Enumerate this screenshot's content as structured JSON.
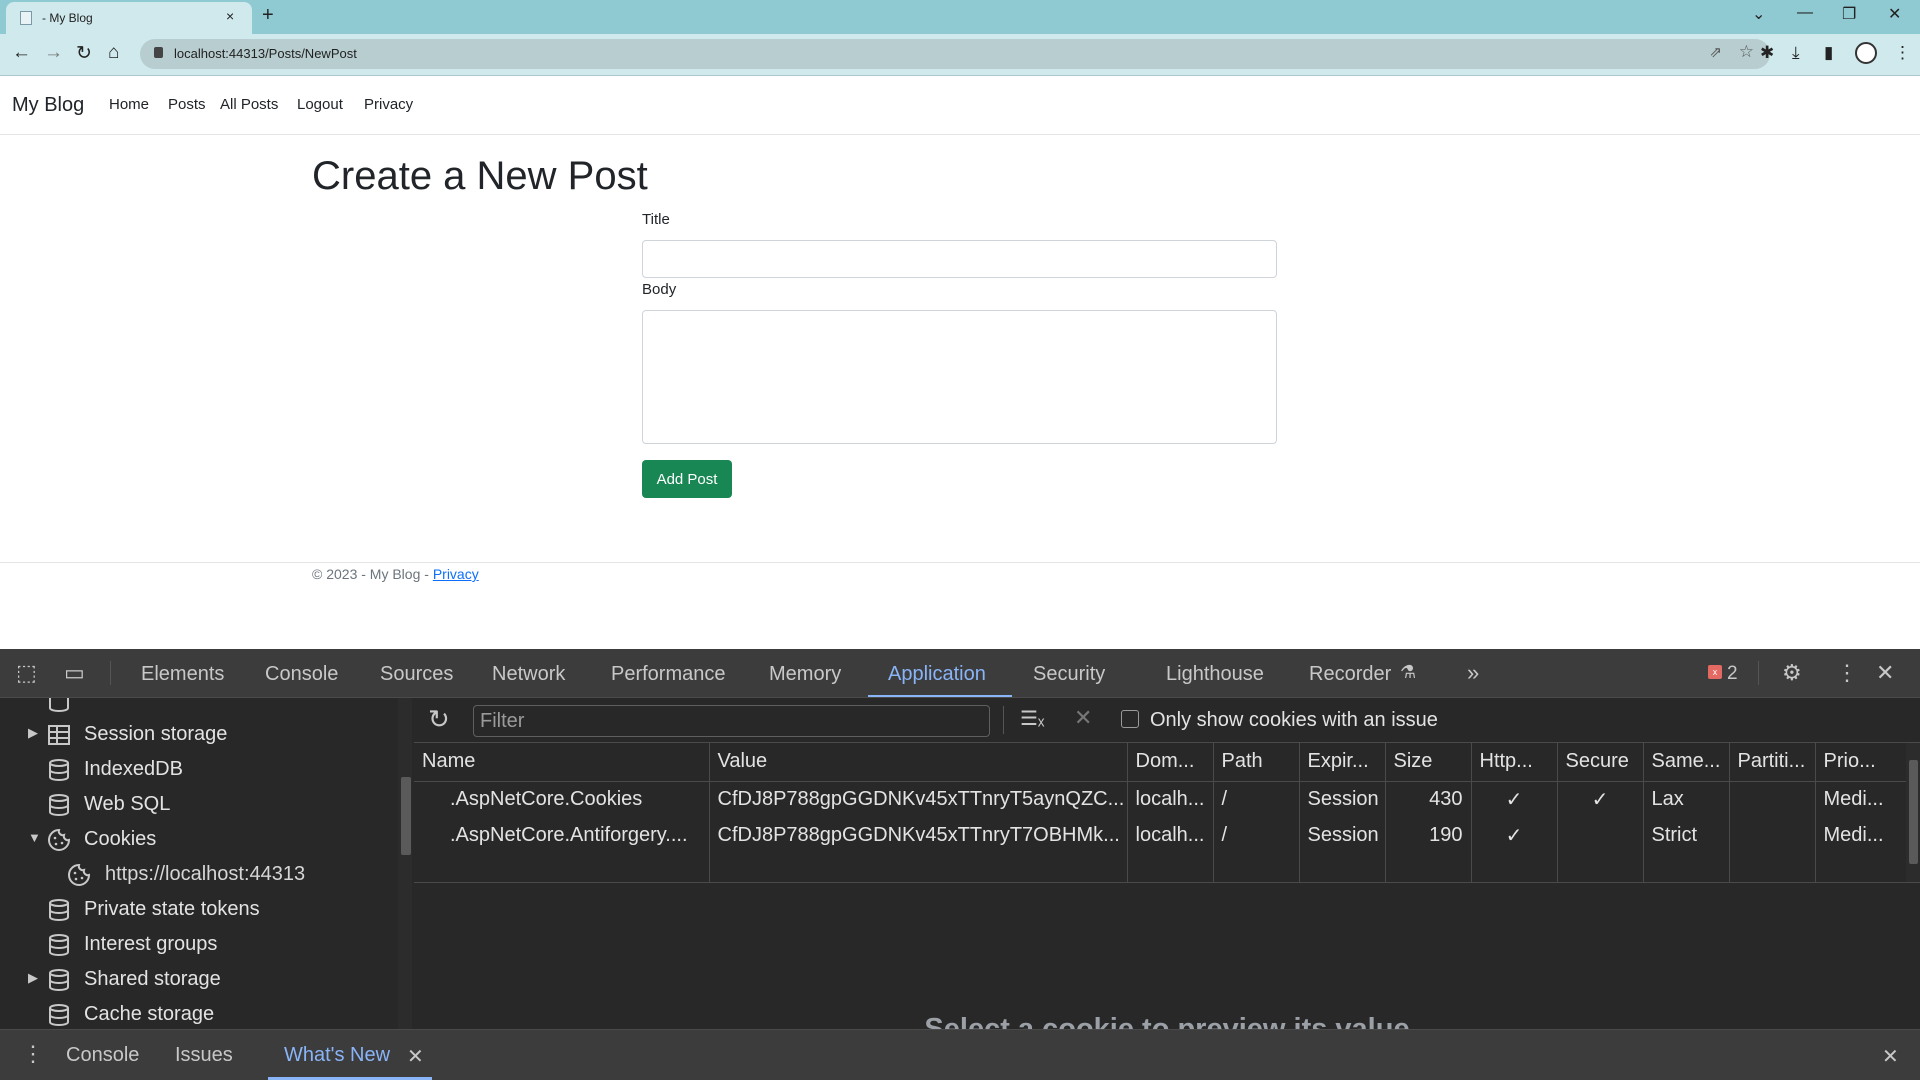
{
  "browser": {
    "tab_title": "- My Blog",
    "tab_close": "×",
    "new_tab": "+",
    "url": "localhost:44313/Posts/NewPost",
    "window_controls": {
      "tab_search": "⌄",
      "minimize": "—",
      "restore": "❐",
      "close": "✕"
    },
    "nav": {
      "back": "←",
      "forward": "→",
      "reload": "↻",
      "home": "⌂"
    },
    "toolbar_icons": {
      "share": "⇗",
      "bookmark": "☆",
      "extensions": "✱",
      "downloads": "⤓",
      "side_panel": "▮",
      "menu": "⋮"
    }
  },
  "page": {
    "brand": "My Blog",
    "nav_links": [
      "Home",
      "Posts",
      "All Posts",
      "Logout",
      "Privacy"
    ],
    "heading": "Create a New Post",
    "form": {
      "title_label": "Title",
      "title_value": "",
      "body_label": "Body",
      "body_value": "",
      "submit_label": "Add Post"
    },
    "footer": {
      "text": "© 2023 - My Blog - ",
      "link": "Privacy"
    }
  },
  "devtools": {
    "tabs": [
      "Elements",
      "Console",
      "Sources",
      "Network",
      "Performance",
      "Memory",
      "Application",
      "Security",
      "Lighthouse",
      "Recorder"
    ],
    "active_tab": "Application",
    "more_tabs": "»",
    "issues_count": "2",
    "sidebar": {
      "items": [
        {
          "label": "Session storage",
          "icon": "table-icon",
          "expandable": true,
          "expanded": false
        },
        {
          "label": "IndexedDB",
          "icon": "database-icon",
          "expandable": false
        },
        {
          "label": "Web SQL",
          "icon": "database-icon",
          "expandable": false
        },
        {
          "label": "Cookies",
          "icon": "cookie-icon",
          "expandable": true,
          "expanded": true
        },
        {
          "label": "https://localhost:44313",
          "icon": "cookie-icon",
          "child": true,
          "selected": true
        },
        {
          "label": "Private state tokens",
          "icon": "database-icon",
          "expandable": false
        },
        {
          "label": "Interest groups",
          "icon": "database-icon",
          "expandable": false
        },
        {
          "label": "Shared storage",
          "icon": "database-icon",
          "expandable": true,
          "expanded": false
        },
        {
          "label": "Cache storage",
          "icon": "database-icon",
          "expandable": false
        }
      ]
    },
    "cookies": {
      "filter_placeholder": "Filter",
      "filter_value": "",
      "only_issues_label": "Only show cookies with an issue",
      "only_issues_checked": false,
      "columns": [
        "Name",
        "Value",
        "Dom...",
        "Path",
        "Expir...",
        "Size",
        "Http...",
        "Secure",
        "Same...",
        "Partiti...",
        "Prio..."
      ],
      "rows": [
        {
          "name": ".AspNetCore.Cookies",
          "value": "CfDJ8P788gpGGDNKv45xTTnryT5aynQZC...",
          "domain": "localh...",
          "path": "/",
          "expires": "Session",
          "size": "430",
          "httponly": "✓",
          "secure": "✓",
          "samesite": "Lax",
          "partition": "",
          "priority": "Medi..."
        },
        {
          "name": ".AspNetCore.Antiforgery....",
          "value": "CfDJ8P788gpGGDNKv45xTTnryT7OBHMk...",
          "domain": "localh...",
          "path": "/",
          "expires": "Session",
          "size": "190",
          "httponly": "✓",
          "secure": "",
          "samesite": "Strict",
          "partition": "",
          "priority": "Medi..."
        }
      ],
      "preview_message": "Select a cookie to preview its value"
    },
    "drawer": {
      "tabs": [
        "Console",
        "Issues",
        "What's New"
      ],
      "active_tab": "What's New"
    }
  }
}
